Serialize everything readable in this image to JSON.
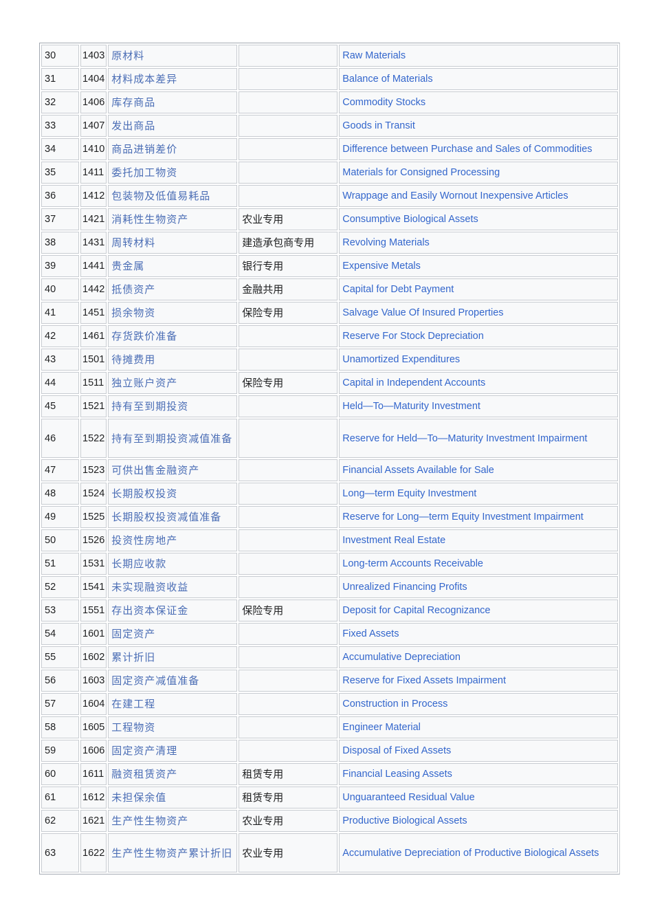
{
  "rows": [
    [
      "30",
      "1403",
      "原材料",
      "",
      "Raw Materials"
    ],
    [
      "31",
      "1404",
      "材料成本差异",
      "",
      "Balance of Materials"
    ],
    [
      "32",
      "1406",
      "库存商品",
      "",
      "Commodity Stocks"
    ],
    [
      "33",
      "1407",
      "发出商品",
      "",
      "Goods in Transit"
    ],
    [
      "34",
      "1410",
      "商品进销差价",
      "",
      "Difference between Purchase and Sales of Commodities"
    ],
    [
      "35",
      "1411",
      "委托加工物资",
      "",
      "Materials for Consigned Processing"
    ],
    [
      "36",
      "1412",
      "包装物及低值易耗品",
      "",
      "Wrappage and Easily Wornout Inexpensive Articles"
    ],
    [
      "37",
      "1421",
      "消耗性生物资产",
      "农业专用",
      "Consumptive Biological Assets"
    ],
    [
      "38",
      "1431",
      "周转材料",
      "建造承包商专用",
      "Revolving Materials"
    ],
    [
      "39",
      "1441",
      "贵金属",
      "银行专用",
      "Expensive Metals"
    ],
    [
      "40",
      "1442",
      "抵债资产",
      "金融共用",
      "Capital for Debt Payment"
    ],
    [
      "41",
      "1451",
      "损余物资",
      "保险专用",
      "Salvage Value Of Insured Properties"
    ],
    [
      "42",
      "1461",
      "存货跌价准备",
      "",
      "Reserve For Stock Depreciation"
    ],
    [
      "43",
      "1501",
      "待摊费用",
      "",
      "Unamortized Expenditures"
    ],
    [
      "44",
      "1511",
      "独立账户资产",
      "保险专用",
      "Capital in Independent Accounts"
    ],
    [
      "45",
      "1521",
      "持有至到期投资",
      "",
      "Held—To—Maturity Investment"
    ],
    [
      "46",
      "1522",
      "持有至到期投资减值准备",
      "",
      "Reserve for Held—To—Maturity Investment Impairment"
    ],
    [
      "47",
      "1523",
      "可供出售金融资产",
      "",
      "Financial Assets Available for Sale"
    ],
    [
      "48",
      "1524",
      "长期股权投资",
      "",
      "Long—term Equity Investment"
    ],
    [
      "49",
      "1525",
      "长期股权投资减值准备",
      "",
      "Reserve for Long—term Equity Investment Impairment"
    ],
    [
      "50",
      "1526",
      "投资性房地产",
      "",
      "Investment Real Estate"
    ],
    [
      "51",
      "1531",
      "长期应收款",
      "",
      "Long-term Accounts Receivable"
    ],
    [
      "52",
      "1541",
      "未实现融资收益",
      "",
      "Unrealized Financing Profits"
    ],
    [
      "53",
      "1551",
      "存出资本保证金",
      "保险专用",
      "Deposit for Capital Recognizance"
    ],
    [
      "54",
      "1601",
      "固定资产",
      "",
      "Fixed Assets"
    ],
    [
      "55",
      "1602",
      "累计折旧",
      "",
      "Accumulative Depreciation"
    ],
    [
      "56",
      "1603",
      "固定资产减值准备",
      "",
      "Reserve for Fixed Assets Impairment"
    ],
    [
      "57",
      "1604",
      "在建工程",
      "",
      "Construction in Process"
    ],
    [
      "58",
      "1605",
      "工程物资",
      "",
      "Engineer Material"
    ],
    [
      "59",
      "1606",
      "固定资产清理",
      "",
      "Disposal of Fixed Assets"
    ],
    [
      "60",
      "1611",
      "融资租赁资产",
      "租赁专用",
      "Financial Leasing Assets"
    ],
    [
      "61",
      "1612",
      "未担保余值",
      "租赁专用",
      "Unguaranteed Residual Value"
    ],
    [
      "62",
      "1621",
      "生产性生物资产",
      "农业专用",
      "Productive Biological Assets"
    ],
    [
      "63",
      "1622",
      "生产性生物资产累计折旧",
      "农业专用",
      "Accumulative Depreciation of Productive Biological Assets"
    ]
  ]
}
